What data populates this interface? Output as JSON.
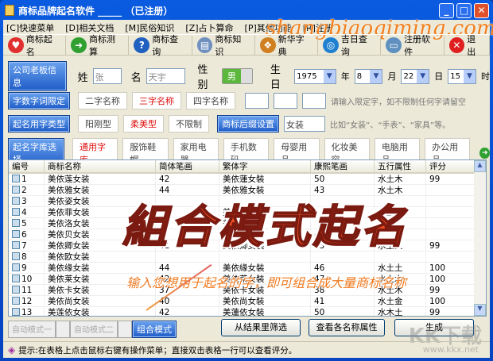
{
  "window": {
    "title": "商标品牌起名软件 _____ （已注册）",
    "min": "_",
    "max": "□",
    "close": "✕"
  },
  "menu": [
    "[C]快速菜单",
    "[D]相关文档",
    "[M]民俗知识",
    "[Z]占卜算命",
    "[P]其他功能",
    "[R]注册"
  ],
  "site": "shangbiaoqiming.com",
  "toolbar": [
    {
      "label": "商标起名",
      "icon": "heart-icon",
      "color": "#e03030",
      "glyph": "♥"
    },
    {
      "label": "商标测算",
      "icon": "arrow-right-icon",
      "color": "#30a030",
      "glyph": "➜"
    },
    {
      "label": "商标查询",
      "icon": "help-icon",
      "color": "#2060c0",
      "glyph": "?"
    },
    {
      "label": "商标知识",
      "icon": "document-icon",
      "color": "#7090c0",
      "glyph": "▤"
    },
    {
      "label": "新华字典",
      "icon": "windows-icon",
      "color": "#d08020",
      "glyph": "❖"
    },
    {
      "label": "吉日查询",
      "icon": "globe-icon",
      "color": "#2080d0",
      "glyph": "◎"
    },
    {
      "label": "注册软件",
      "icon": "computer-icon",
      "color": "#6090c0",
      "glyph": "▭"
    },
    {
      "label": "退出",
      "icon": "close-icon",
      "color": "#e02020",
      "glyph": "✕"
    }
  ],
  "info": {
    "btn": "公司老板信息",
    "surname_label": "姓",
    "surname": "张",
    "name_label": "名",
    "name": "天宇",
    "gender_label": "性别",
    "gender": "男",
    "birth_label": "生日",
    "year": "1975",
    "year_unit": "年",
    "month": "8",
    "month_unit": "月",
    "day": "22",
    "day_unit": "日",
    "hour": "15",
    "hour_unit": "时"
  },
  "length": {
    "btn": "字数字词限定",
    "options": [
      "二字名称",
      "三字名称",
      "四字名称"
    ],
    "hint": "请输入限定字，如不限制任何字请留空"
  },
  "type": {
    "btn": "起名用字类型",
    "options": [
      "阳刚型",
      "柔美型",
      "不限制"
    ],
    "suffix_btn": "商标后缀设置",
    "suffix": "女装",
    "hint": "比如“女装”、“手表”、“家具”等。"
  },
  "library": {
    "btn": "起名字库选择",
    "options": [
      "通用字库",
      "服饰鞋帽",
      "家用电器",
      "手机数码",
      "母婴用品",
      "化妆美容",
      "电脑用品",
      "办公用品"
    ]
  },
  "table": {
    "headers": [
      "编号",
      "商标名称",
      "简体笔画",
      "繁体字",
      "康熙笔画",
      "五行属性",
      "评分"
    ],
    "rows": [
      [
        "1",
        "美依莲女装",
        "42",
        "美依蓮女裝",
        "50",
        "水土木",
        "99"
      ],
      [
        "2",
        "美依雅女装",
        "44",
        "美依雅女裝",
        "43",
        "水土木",
        ""
      ],
      [
        "3",
        "美依姿女装",
        "",
        "",
        "",
        "",
        ""
      ],
      [
        "4",
        "美依菲女装",
        "",
        "美依菲女裝",
        "",
        "水土木",
        ""
      ],
      [
        "5",
        "美依洛女装",
        "",
        "美依洛女裝",
        "",
        "",
        ""
      ],
      [
        "6",
        "美依贝女装",
        "",
        "美依貝女裝",
        "40",
        "",
        ""
      ],
      [
        "7",
        "美依卿女装",
        "41",
        "美依卿女裝",
        "43",
        "水土火",
        "99"
      ],
      [
        "8",
        "美依欧女装",
        "",
        "",
        "",
        "",
        ""
      ],
      [
        "9",
        "美依缘女装",
        "44",
        "美依緣女裝",
        "46",
        "水土土",
        "100"
      ],
      [
        "10",
        "美依莱女装",
        "42",
        "美依萊女裝",
        "47",
        "水土木",
        "100"
      ],
      [
        "11",
        "美依卡女装",
        "37",
        "美依卡女裝",
        "38",
        "水土木",
        "99"
      ],
      [
        "12",
        "美依尚女装",
        "40",
        "美依尚女裝",
        "41",
        "水土金",
        "100"
      ],
      [
        "13",
        "美莲依女装",
        "42",
        "美蓮依女裝",
        "50",
        "水木土",
        "99"
      ]
    ]
  },
  "overlay": {
    "title": "組合模式起名",
    "subtitle": "输入您想用于起名的字，即可组合成大量商标名称"
  },
  "modes": [
    "自动模式一",
    "自动模式二",
    "组合模式"
  ],
  "buttons": {
    "filter": "从结果里筛选",
    "attrs": "查看各名称属性",
    "generate": "生成"
  },
  "status": "提示:在表格上点击鼠标右键有操作菜单；直接双击表格一行可以查看评分。",
  "watermark": {
    "logo": "KK下载",
    "url": "www.kkx.net"
  }
}
